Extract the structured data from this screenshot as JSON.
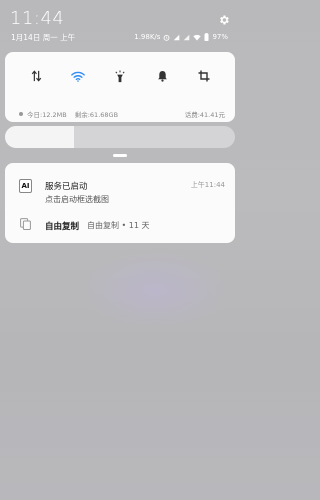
{
  "status_bar": {
    "time": "11:44",
    "date": "1月14日 周一 上午",
    "net_speed": "1.98K/s",
    "battery": "97%",
    "icons": [
      "settings-gear-icon",
      "alarm-icon",
      "signal-icon",
      "wifi-icon",
      "battery-icon"
    ]
  },
  "quick_settings": {
    "toggles": [
      {
        "name": "mobile-data",
        "icon": "data-arrows-icon",
        "active": false
      },
      {
        "name": "wifi",
        "icon": "wifi-icon",
        "active": true
      },
      {
        "name": "flashlight",
        "icon": "flashlight-icon",
        "active": false
      },
      {
        "name": "notifications",
        "icon": "bell-icon",
        "active": false
      },
      {
        "name": "screenshot",
        "icon": "crop-icon",
        "active": false
      }
    ],
    "data_today": "今日:12.2MB",
    "data_remaining": "剩余:61.68GB",
    "balance": "话费:41.41元",
    "accent_color": "#2f8df5"
  },
  "brightness": {
    "level": 0.3
  },
  "notifications": {
    "app_icon_text": "AI",
    "title": "服务已启动",
    "time": "上午11:44",
    "body": "点击启动框选截图",
    "app_name": "自由复制",
    "app_meta": "自由复制 • 11 天"
  }
}
